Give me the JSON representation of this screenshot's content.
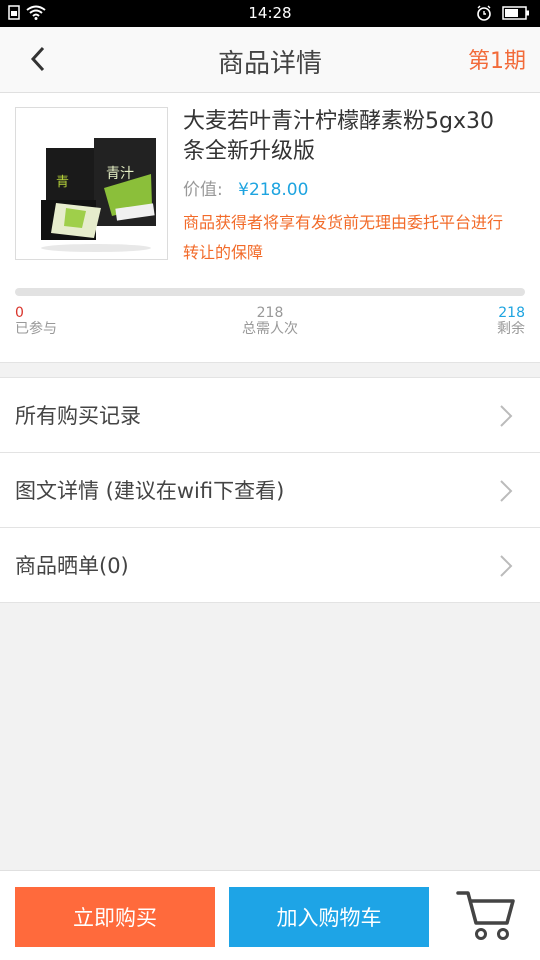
{
  "status_bar": {
    "time": "14:28"
  },
  "header": {
    "title": "商品详情",
    "period": "第1期"
  },
  "product": {
    "title": "大麦若叶青汁柠檬酵素粉5gx30条全新升级版",
    "value_label": "价值:",
    "value_amount": "¥218.00",
    "notice": "商品获得者将享有发货前无理由委托平台进行转让的保障"
  },
  "progress": {
    "fraction": 0,
    "joined_value": "0",
    "joined_label": "已参与",
    "total_value": "218",
    "total_label": "总需人次",
    "remaining_value": "218",
    "remaining_label": "剩余"
  },
  "menu": {
    "items": [
      {
        "label": "所有购买记录"
      },
      {
        "label": "图文详情 (建议在wifi下查看)"
      },
      {
        "label": "商品晒单(0)"
      }
    ]
  },
  "bottom": {
    "buy_label": "立即购买",
    "add_cart_label": "加入购物车"
  },
  "colors": {
    "accent_orange": "#ff6a3c",
    "accent_blue": "#1ea4e6"
  }
}
